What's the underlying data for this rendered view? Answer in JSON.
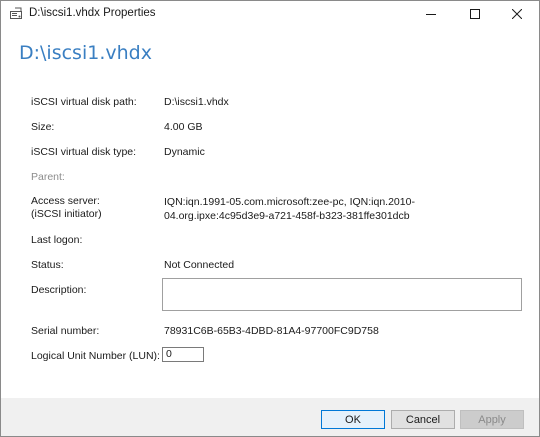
{
  "window": {
    "title": "D:\\iscsi1.vhdx Properties"
  },
  "heading": "D:\\iscsi1.vhdx",
  "fields": {
    "path_label": "iSCSI virtual disk path:",
    "path_value": "D:\\iscsi1.vhdx",
    "size_label": "Size:",
    "size_value": "4.00 GB",
    "type_label": "iSCSI virtual disk type:",
    "type_value": "Dynamic",
    "parent_label": "Parent:",
    "access_label_1": "Access server:",
    "access_label_2": "(iSCSI initiator)",
    "access_value": "IQN:iqn.1991-05.com.microsoft:zee-pc, IQN:iqn.2010-04.org.ipxe:4c95d3e9-a721-458f-b323-381ffe301dcb",
    "last_logon_label": "Last logon:",
    "status_label": "Status:",
    "status_value": "Not Connected",
    "description_label": "Description:",
    "description_value": "",
    "serial_label": "Serial number:",
    "serial_value": "78931C6B-65B3-4DBD-81A4-97700FC9D758",
    "lun_label": "Logical Unit Number (LUN):",
    "lun_value": "0"
  },
  "buttons": {
    "ok": "OK",
    "cancel": "Cancel",
    "apply": "Apply"
  },
  "icons": {
    "title": "disk-properties-icon",
    "minimize": "minimize-icon",
    "maximize": "maximize-icon",
    "close": "close-icon"
  },
  "colors": {
    "heading": "#3a7fc2",
    "ok_border": "#0078d7",
    "footer": "#f0f0f0"
  }
}
